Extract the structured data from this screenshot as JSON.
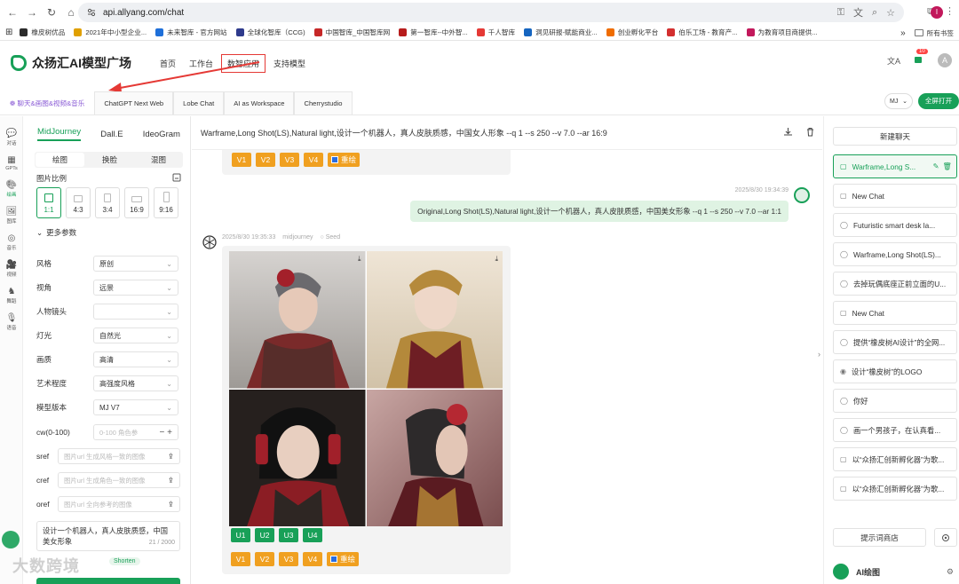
{
  "browser": {
    "url": "api.allyang.com/chat",
    "bookmarks": [
      "橡皮树优品",
      "2021年中小型企业...",
      "未来智库 - 官方网站",
      "全球化智库（CCG)",
      "中国智库_中国智库网",
      "第一智库--中外智...",
      "千人智库",
      "洞见研报-赋能商业...",
      "创业孵化平台",
      "伯乐工场 - 教育产...",
      "为教育项目商提供..."
    ],
    "bookmark_colors": [
      "#2b2b2b",
      "#e0a000",
      "#1e6fd9",
      "#2e3a8c",
      "#c62828",
      "#b71c1c",
      "#e53935",
      "#1565c0",
      "#ef6c00",
      "#d32f2f",
      "#c2185b"
    ],
    "all_bookmarks": "所有书签",
    "avatar_letter": "I"
  },
  "app": {
    "title": "众扬汇AI模型广场",
    "nav": [
      "首页",
      "工作台",
      "数智应用",
      "支持模型"
    ],
    "nav_active": 2,
    "badge": "10",
    "avatar_letter": "A"
  },
  "tabs": {
    "items": [
      "聊天&画图&视频&音乐",
      "ChatGPT Next Web",
      "Lobe Chat",
      "AI as Workspace",
      "Cherrystudio"
    ],
    "model": "MJ",
    "fullscreen": "全屏打开"
  },
  "rail": [
    "对话",
    "GPTs",
    "绘画",
    "图库",
    "音乐",
    "视频",
    "舞蹈",
    "语音"
  ],
  "params": {
    "providers": [
      "MidJourney",
      "Dall.E",
      "IdeoGram"
    ],
    "modes": [
      "绘图",
      "换脸",
      "混图"
    ],
    "ratio_title": "图片比例",
    "ratios": [
      "1:1",
      "4:3",
      "3:4",
      "16:9",
      "9:16"
    ],
    "more": "更多参数",
    "rows": [
      {
        "label": "风格",
        "value": "原创"
      },
      {
        "label": "视角",
        "value": "远景"
      },
      {
        "label": "人物镜头",
        "value": ""
      },
      {
        "label": "灯光",
        "value": "自然光"
      },
      {
        "label": "画质",
        "value": "高清"
      },
      {
        "label": "艺术程度",
        "value": "高强度风格"
      },
      {
        "label": "模型版本",
        "value": "MJ V7"
      }
    ],
    "cw_label": "cw(0-100)",
    "cw_placeholder": "0-100 角色参",
    "sref": {
      "label": "sref",
      "placeholder": "图片url 生成风格一致的图像"
    },
    "cref": {
      "label": "cref",
      "placeholder": "图片url 生成角色一致的图像"
    },
    "oref": {
      "label": "oref",
      "placeholder": "图片url 全向参考的图像"
    },
    "prompt": "设计一个机器人，真人皮肤质感，中国美女形象",
    "prompt_count": "21 / 2000",
    "shorten": "Shorten",
    "watermark": "大数跨境"
  },
  "chat": {
    "header": "Warframe,Long Shot(LS),Natural light,设计一个机器人，真人皮肤质感，中国女人形象 --q 1 --s 250 --v 7.0 --ar 16:9",
    "vbuttons": [
      "V1",
      "V2",
      "V3",
      "V4"
    ],
    "ubuttons": [
      "U1",
      "U2",
      "U3",
      "U4"
    ],
    "redraw": "重绘",
    "user_time": "2025/8/30 19:34:39",
    "user_msg": "Original,Long Shot(LS),Natural light,设计一个机器人，真人皮肤质感，中国美女形象 --q 1 --s 250 --v 7.0 --ar 1:1",
    "bot_time": "2025/8/30 19:35:33",
    "bot_model": "midjourney",
    "bot_seed": "Seed"
  },
  "sidebar": {
    "new_chat": "新建聊天",
    "items": [
      "Warframe,Long S...",
      "New Chat",
      "Futuristic smart desk la...",
      "Warframe,Long Shot(LS)...",
      "去掉玩偶底座正前立面的U...",
      "New Chat",
      "提供“橡皮树AI设计”的全网...",
      "设计“橡皮树”的LOGO",
      "你好",
      "画一个男孩子，在认真看...",
      "以“众扬汇创新孵化器”为歌...",
      "以“众扬汇创新孵化器”为歌..."
    ],
    "active": 0,
    "prompt_shop": "提示词商店",
    "footer": "AI绘图"
  }
}
